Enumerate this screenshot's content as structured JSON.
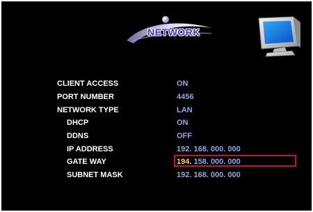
{
  "header": {
    "title": "NETWORK",
    "logo_icon": "swoosh-globe-icon",
    "monitor_icon": "monitor-icon"
  },
  "settings": [
    {
      "label": "CLIENT ACCESS",
      "value": "ON"
    },
    {
      "label": "PORT NUMBER",
      "value": "4456"
    },
    {
      "label": "NETWORK TYPE",
      "value": "LAN"
    },
    {
      "label": "DHCP",
      "value": "ON"
    },
    {
      "label": "DDNS",
      "value": "OFF"
    },
    {
      "label": "IP ADDRESS",
      "value": "192. 168. 000. 000"
    },
    {
      "label": "GATE WAY",
      "value_highlight": "194.",
      "value_rest": " 158. 000. 000"
    },
    {
      "label": "SUBNET MASK",
      "value": "192. 168. 000. 000"
    }
  ],
  "colors": {
    "background": "#000000",
    "label": "#ffffff",
    "value": "#8fa6e8",
    "active_digit": "#ffd23f",
    "selection_border": "#c8102e"
  }
}
